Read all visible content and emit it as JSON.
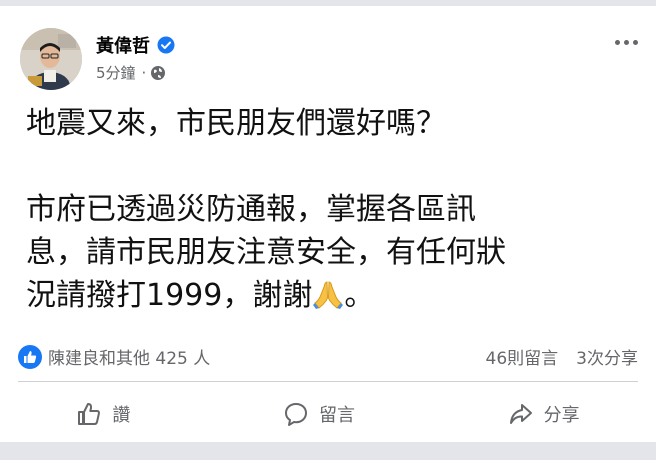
{
  "post": {
    "author": "黃偉哲",
    "verified_icon": "verified-badge-icon",
    "timestamp": "5分鐘",
    "meta_separator": "·",
    "privacy_icon": "globe-icon",
    "more_icon": "more-options-icon",
    "body_line1": "地震又來，市民朋友們還好嗎？",
    "body_line2": "市府已透過災防通報，掌握各區訊",
    "body_line3": "息，請市民朋友注意安全，有任何狀",
    "body_line4_text": "況請撥打1999，謝謝",
    "body_emoji": "folded-hands-emoji",
    "body_line4_end": "。"
  },
  "reactions": {
    "like_icon": "like-reaction-icon",
    "summary": "陳建良和其他 425 人",
    "comments": "46則留言",
    "shares": "3次分享"
  },
  "actions": {
    "like_label": "讚",
    "comment_label": "留言",
    "share_label": "分享"
  },
  "colors": {
    "accent": "#1877f2",
    "secondary_text": "#65676b",
    "background": "#e4e5ea"
  }
}
